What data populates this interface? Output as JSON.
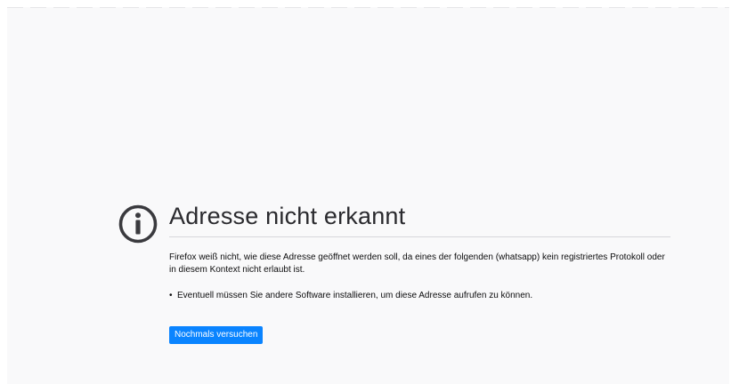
{
  "error_page": {
    "icon": "info-icon",
    "title": "Adresse nicht erkannt",
    "description": "Firefox weiß nicht, wie diese Adresse geöffnet werden soll, da eines der folgenden (whatsapp) kein registriertes Protokoll oder in diesem Kontext nicht erlaubt ist.",
    "suggestions": [
      "Eventuell müssen Sie andere Software installieren, um diese Adresse aufrufen zu können."
    ],
    "retry_label": "Nochmals versuchen"
  },
  "colors": {
    "background": "#f9f9fa",
    "title_text": "#2a2a2e",
    "body_text": "#0c0c0d",
    "button_bg": "#0a84ff",
    "button_text": "#ffffff",
    "divider": "#d7d7db"
  }
}
